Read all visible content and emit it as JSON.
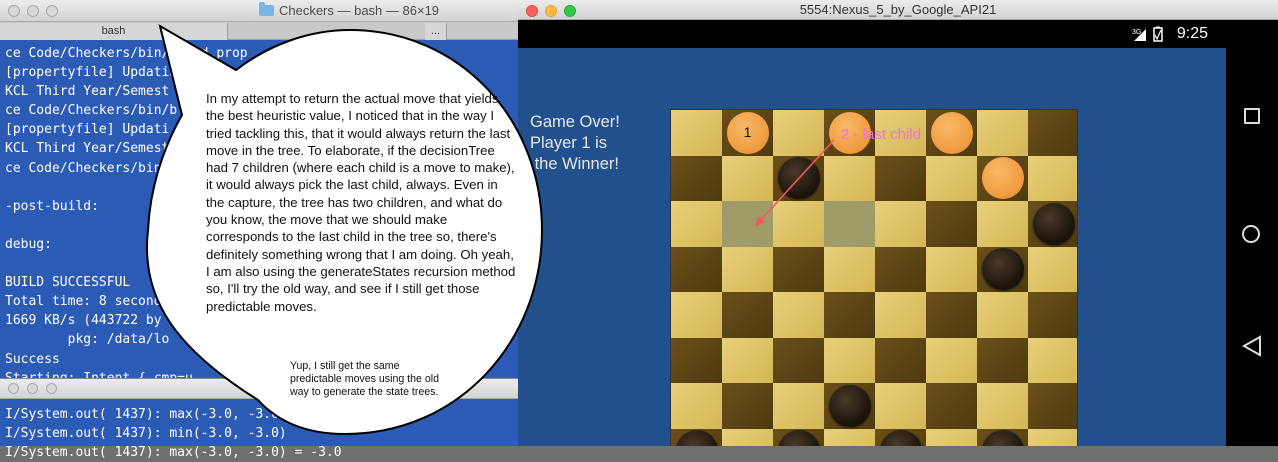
{
  "terminal": {
    "title": "Checkers — bash — 86×19",
    "tabs": [
      "bash",
      "..."
    ],
    "lines": [
      "ce Code/Checkers/bin/build.prop",
      "[propertyfile] Updating         oogle D",
      "KCL Third Year/Semest           oject",
      "ce Code/Checkers/bin/b",
      "[propertyfile] Updati",
      "KCL Third Year/Semest",
      "ce Code/Checkers/bin/b",
      "",
      "-post-build:",
      "",
      "debug:",
      "",
      "BUILD SUCCESSFUL",
      "Total time: 8 second",
      "1669 KB/s (443722 by",
      "        pkg: /data/lo",
      "Success",
      "Starting: Intent { cmp=u"
    ]
  },
  "terminal2": {
    "lines": [
      "I/System.out( 1437): max(-3.0, -3.0",
      "I/System.out( 1437): min(-3.0, -3.0)",
      "I/System.out( 1437): max(-3.0, -3.0) = -3.0"
    ]
  },
  "emulator": {
    "title": "5554:Nexus_5_by_Google_API21",
    "status": {
      "network": "3G",
      "time": "9:25"
    },
    "game_over_text": "Game Over!\nPlayer 1 is\n the Winner!",
    "annotation_label": "2 - last child",
    "piece_label": "1",
    "board": {
      "rows": 8,
      "cols": 8,
      "highlighted": [
        [
          2,
          1
        ],
        [
          2,
          3
        ]
      ],
      "pieces": [
        {
          "row": 0,
          "col": 1,
          "color": "orange",
          "label": "1"
        },
        {
          "row": 0,
          "col": 3,
          "color": "orange"
        },
        {
          "row": 0,
          "col": 5,
          "color": "orange"
        },
        {
          "row": 1,
          "col": 6,
          "color": "orange"
        },
        {
          "row": 1,
          "col": 2,
          "color": "black"
        },
        {
          "row": 2,
          "col": 7,
          "color": "black"
        },
        {
          "row": 3,
          "col": 6,
          "color": "black"
        },
        {
          "row": 6,
          "col": 3,
          "color": "black"
        },
        {
          "row": 7,
          "col": 0,
          "color": "black"
        },
        {
          "row": 7,
          "col": 2,
          "color": "black"
        },
        {
          "row": 7,
          "col": 4,
          "color": "black"
        },
        {
          "row": 7,
          "col": 6,
          "color": "black"
        }
      ]
    }
  },
  "bubble": {
    "main_text": "In my attempt to return the actual move that yields the best heuristic value, I noticed that in the way I tried tackling this, that it would always return the last move in the tree. To elaborate, if the decisionTree had 7 children (where each child is a move to make), it would always pick the last child, always. Even in the capture, the tree has two children,  and what do you know, the move that we should make corresponds to the last child in the tree so, there's definitely something wrong that I am doing. Oh yeah, I am also using the generateStates recursion method so, I'll try the old way, and see if I still get those predictable moves.",
    "small_text": "Yup, I still get the same predictable moves using the old way to generate the state trees."
  },
  "colors": {
    "terminal_bg": "#2b5bb4",
    "screen_bg": "#21508c",
    "annotation": "#f070e0",
    "arrow": "#f05a5a"
  }
}
